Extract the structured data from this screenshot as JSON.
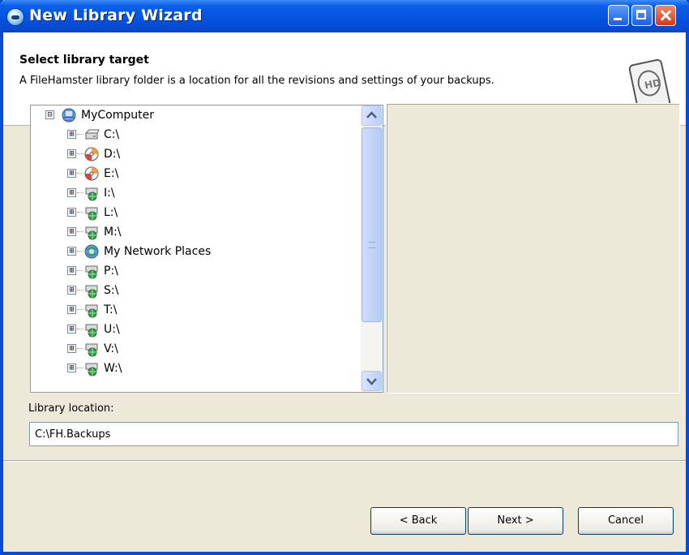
{
  "window": {
    "title": "New Library Wizard"
  },
  "header": {
    "title": "Select library target",
    "description": "A FileHamster library folder is a location for all the revisions and settings of your backups."
  },
  "tree": {
    "root": {
      "label": "MyComputer",
      "expander": "⊟",
      "icon": "computer-icon"
    },
    "items": [
      {
        "label": "C:\\",
        "icon": "hard-drive-icon"
      },
      {
        "label": "D:\\",
        "icon": "cd-drive-icon"
      },
      {
        "label": "E:\\",
        "icon": "cd-drive-icon"
      },
      {
        "label": "I:\\",
        "icon": "network-drive-icon"
      },
      {
        "label": "L:\\",
        "icon": "network-drive-icon"
      },
      {
        "label": "M:\\",
        "icon": "network-drive-icon"
      },
      {
        "label": "My Network Places",
        "icon": "network-places-icon"
      },
      {
        "label": "P:\\",
        "icon": "network-drive-icon"
      },
      {
        "label": "S:\\",
        "icon": "network-drive-icon"
      },
      {
        "label": "T:\\",
        "icon": "network-drive-icon"
      },
      {
        "label": "U:\\",
        "icon": "network-drive-icon"
      },
      {
        "label": "V:\\",
        "icon": "network-drive-icon"
      },
      {
        "label": "W:\\",
        "icon": "network-drive-icon"
      }
    ],
    "expander_collapsed": "⊞"
  },
  "location": {
    "label": "Library location:",
    "value": "C:\\FH.Backups"
  },
  "buttons": {
    "back": "< Back",
    "next": "Next >",
    "cancel": "Cancel"
  },
  "colors": {
    "titlebar": "#0553e0",
    "dialog_face": "#ece9d8",
    "border": "#7f9db9"
  }
}
